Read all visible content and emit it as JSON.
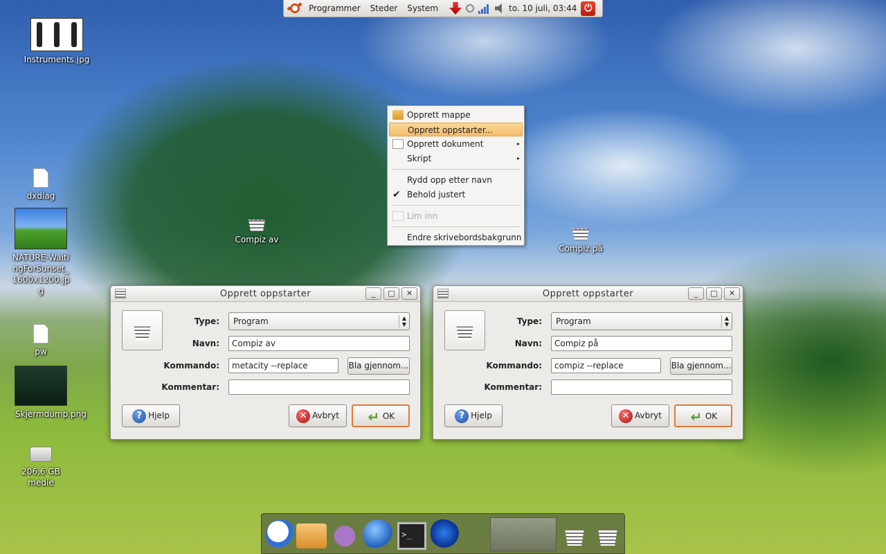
{
  "top_panel": {
    "menus": [
      "Programmer",
      "Steder",
      "System"
    ],
    "clock": "to. 10 juli, 03:44",
    "icons": [
      "ubuntu-logo",
      "update-notifier-icon",
      "search-icon",
      "network-signal-icon",
      "volume-icon",
      "power-icon"
    ]
  },
  "desktop_icons": [
    {
      "label": "Instruments.jpg",
      "icon": "image-thumbnail"
    },
    {
      "label": "dxdiag",
      "icon": "document-icon"
    },
    {
      "label": "NATURE-WaitingForSunset_1600x1200.jpg",
      "icon": "image-thumbnail"
    },
    {
      "label": "pw",
      "icon": "document-icon"
    },
    {
      "label": "Skjermdump.png",
      "icon": "image-thumbnail"
    },
    {
      "label": "206,6 GB medie",
      "icon": "drive-icon"
    },
    {
      "label": "Compiz av",
      "icon": "launcher-spring-icon"
    },
    {
      "label": "Compiz på",
      "icon": "launcher-spring-icon"
    }
  ],
  "context_menu": {
    "items": [
      {
        "label": "Opprett mappe",
        "icon": "folder-icon"
      },
      {
        "label": "Opprett oppstarter...",
        "highlighted": true
      },
      {
        "label": "Opprett dokument",
        "icon": "document-new-icon",
        "submenu": true
      },
      {
        "label": "Skript",
        "submenu": true
      },
      {
        "label": "Rydd opp etter navn"
      },
      {
        "label": "Behold justert",
        "checked": true
      },
      {
        "label": "Lim inn",
        "disabled": true,
        "icon": "paste-icon"
      },
      {
        "label": "Endre skrivebordsbakgrunn"
      }
    ]
  },
  "dialogs": [
    {
      "title": "Opprett oppstarter",
      "type_label": "Type:",
      "type_value": "Program",
      "name_label": "Navn:",
      "name_value": "Compiz av",
      "command_label": "Kommando:",
      "command_value": "metacity --replace",
      "browse_label": "Bla gjennom...",
      "comment_label": "Kommentar:",
      "comment_value": "",
      "help_label": "Hjelp",
      "cancel_label": "Avbryt",
      "ok_label": "OK",
      "window_buttons": [
        "_",
        "□",
        "✕"
      ]
    },
    {
      "title": "Opprett oppstarter",
      "type_label": "Type:",
      "type_value": "Program",
      "name_label": "Navn:",
      "name_value": "Compiz på",
      "command_label": "Kommando:",
      "command_value": "compiz --replace",
      "browse_label": "Bla gjennom...",
      "comment_label": "Kommentar:",
      "comment_value": "",
      "help_label": "Hjelp",
      "cancel_label": "Avbryt",
      "ok_label": "OK",
      "window_buttons": [
        "_",
        "□",
        "✕"
      ]
    }
  ],
  "dock": {
    "items": [
      "beagle-search-icon",
      "file-manager-folder-icon",
      "pidgin-chat-icon",
      "web-browser-globe-icon",
      "terminal-icon",
      "frog-app-icon",
      "window-preview-thumbnail",
      "compiz-av-launcher-icon",
      "compiz-pa-launcher-icon"
    ],
    "terminal_prompt": ">_"
  }
}
